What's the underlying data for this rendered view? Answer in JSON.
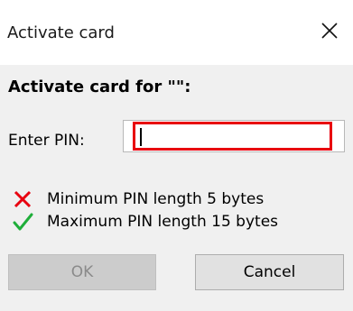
{
  "window": {
    "title": "Activate card",
    "close_icon": "close-icon"
  },
  "main": {
    "heading": "Activate card for \"\":",
    "pin_label": "Enter PIN:",
    "pin_value": "",
    "rules": [
      {
        "text": "Minimum PIN length 5 bytes",
        "icon": "cross-icon",
        "status": "fail",
        "color": "#e8000f"
      },
      {
        "text": "Maximum PIN length 15 bytes",
        "icon": "check-icon",
        "status": "pass",
        "color": "#1fae3a"
      }
    ]
  },
  "buttons": {
    "ok_label": "OK",
    "cancel_label": "Cancel"
  },
  "colors": {
    "error_border": "#e8000f",
    "ok_disabled_bg": "#cccccc",
    "body_bg": "#f0f0f0"
  }
}
